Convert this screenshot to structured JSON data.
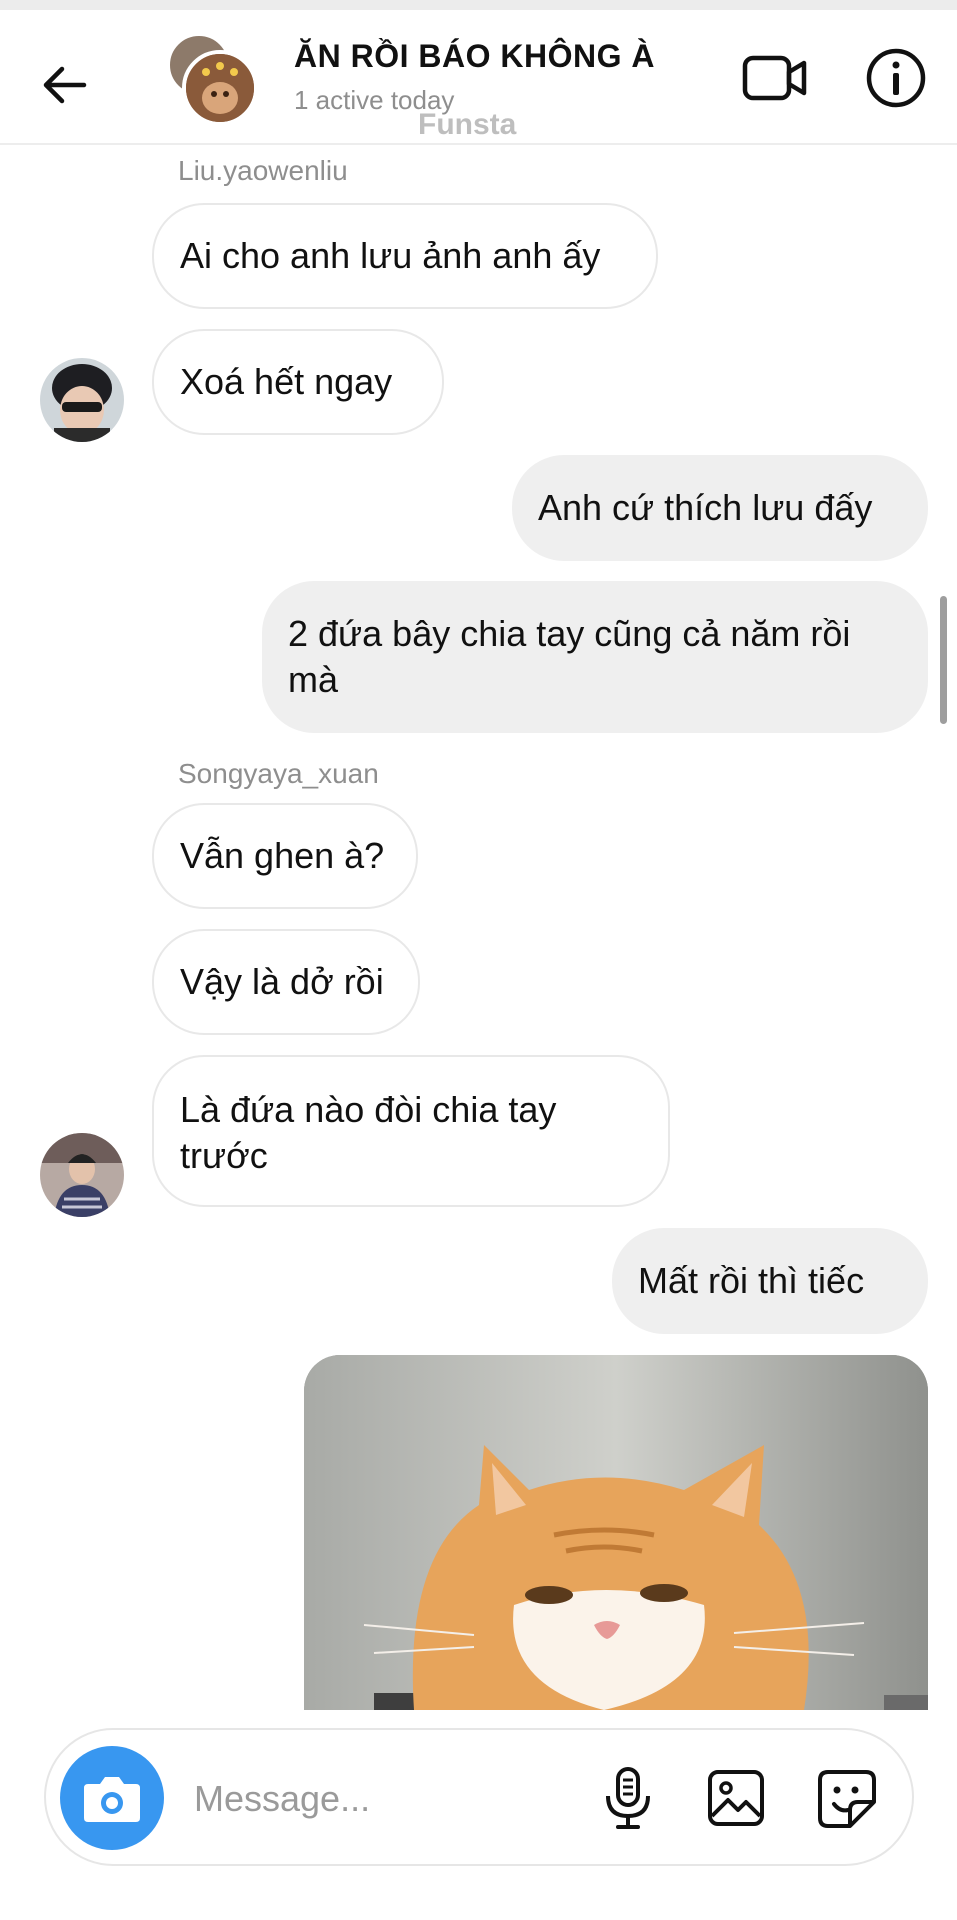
{
  "header": {
    "title": "ĂN RỒI BÁO KHÔNG À",
    "subtitle": "1 active today",
    "watermark": "Funsta"
  },
  "icons": {
    "back": "back-arrow-icon",
    "video": "video-camera-icon",
    "info": "info-icon",
    "camera": "camera-icon",
    "mic": "microphone-icon",
    "gallery": "image-gallery-icon",
    "sticker": "sticker-icon"
  },
  "messages": [
    {
      "sender": "Liu.yaowenliu"
    },
    {
      "text": "Ai cho anh lưu ảnh anh ấy",
      "dir": "in"
    },
    {
      "text": "Xoá hết ngay",
      "dir": "in"
    },
    {
      "text": "Anh cứ thích lưu đấy",
      "dir": "out"
    },
    {
      "text_line1": "2 đứa bây chia tay cũng cả năm rồi",
      "text_line2": "mà",
      "dir": "out"
    },
    {
      "sender": "Songyaya_xuan"
    },
    {
      "text": "Vẫn ghen à?",
      "dir": "in"
    },
    {
      "text": "Vậy là dở rồi",
      "dir": "in"
    },
    {
      "text_line1": "Là đứa nào đòi chia tay",
      "text_line2": "trước",
      "dir": "in"
    },
    {
      "text": "Mất rồi thì tiếc",
      "dir": "out"
    }
  ],
  "composer": {
    "placeholder": "Message..."
  },
  "colors": {
    "accent": "#3897f0",
    "bubble_out": "#efefef",
    "bubble_in_border": "#e8e8e8",
    "muted_text": "#8e8e8e"
  }
}
